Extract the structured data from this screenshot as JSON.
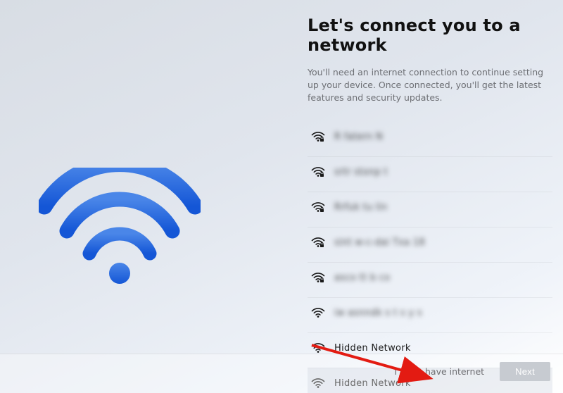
{
  "header": {
    "title": "Let's connect you to a network",
    "description": "You'll need an internet connection to continue setting up your device. Once connected, you'll get the latest features and security updates."
  },
  "networks": [
    {
      "ssid": "R    fatern  N",
      "secured": true,
      "blurred": true,
      "selected": false
    },
    {
      "ssid": "srtr  stonp t",
      "secured": true,
      "blurred": true,
      "selected": false
    },
    {
      "ssid": "Rrfuk  tu lin",
      "secured": true,
      "blurred": true,
      "selected": false
    },
    {
      "ssid": "sint  w-c-dai Txa  18",
      "secured": true,
      "blurred": true,
      "selected": false
    },
    {
      "ssid": "asco tt b  co",
      "secured": true,
      "blurred": true,
      "selected": false
    },
    {
      "ssid": "iw   asnndk  s t s  y s",
      "secured": false,
      "blurred": true,
      "selected": false
    },
    {
      "ssid": "Hidden Network",
      "secured": false,
      "blurred": false,
      "selected": false
    },
    {
      "ssid": "Hidden Network",
      "secured": false,
      "blurred": false,
      "selected": true
    }
  ],
  "footer": {
    "no_internet_label": "I don't have internet",
    "next_label": "Next"
  },
  "illustration": {
    "name": "wifi-illustration",
    "color_top": "#4a86e8",
    "color_bottom": "#1456d6"
  }
}
